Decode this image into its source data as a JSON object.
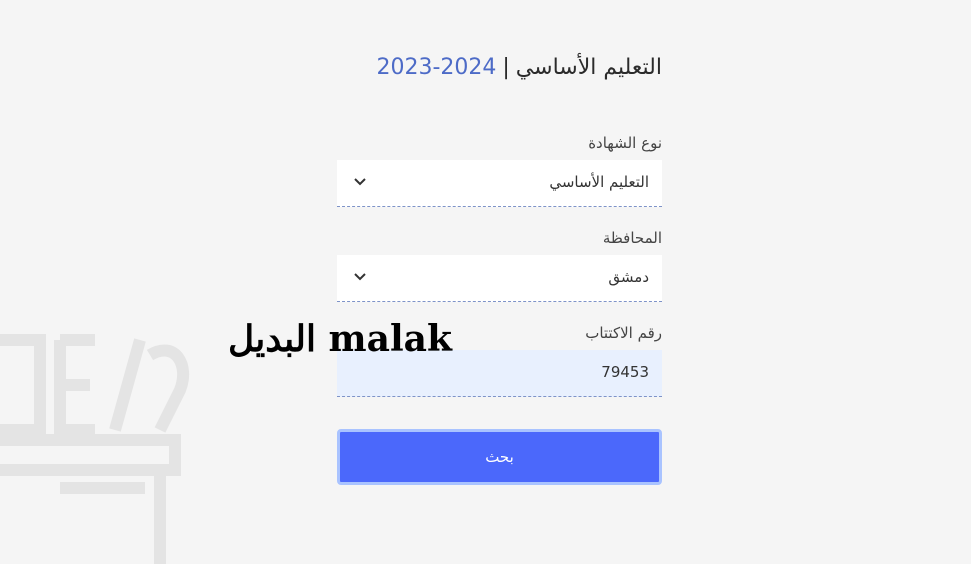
{
  "header": {
    "title": "التعليم الأساسي",
    "separator": "|",
    "year": "2023-2024"
  },
  "form": {
    "certificate_label": "نوع الشهادة",
    "certificate_value": "التعليم الأساسي",
    "province_label": "المحافظة",
    "province_value": "دمشق",
    "subscription_label": "رقم الاكتتاب",
    "subscription_value": "79453",
    "search_label": "بحث"
  },
  "watermark": {
    "text": "malak البديل"
  },
  "colors": {
    "accent": "#4b68fb",
    "year": "#4d6bc7",
    "input_bg": "#e8f0fe"
  }
}
